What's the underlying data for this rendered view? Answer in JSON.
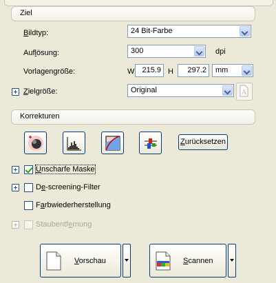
{
  "ziel": {
    "header": "Ziel",
    "bildtyp_label_pre": "",
    "bildtyp_label_ul": "B",
    "bildtyp_label_post": "ildtyp:",
    "bildtyp_value": "24 Bit-Farbe",
    "aufloesung_label_pre": "Auf",
    "aufloesung_label_ul": "l",
    "aufloesung_label_post": "ösung:",
    "aufloesung_value": "300",
    "aufloesung_unit": "dpi",
    "vorlagengroesse_label": "Vorlagengröße:",
    "w_label": "W",
    "w_value": "215.9",
    "h_label": "H",
    "h_value": "297.2",
    "unit_value": "mm",
    "zielgroesse_label_ul": "Z",
    "zielgroesse_label_post": "ielgröße:",
    "zielgroesse_value": "Original"
  },
  "korrekturen": {
    "header": "Korrekturen",
    "reset_label_pre": "",
    "reset_label_ul": "Z",
    "reset_label_post": "urücksetzen",
    "options": {
      "unscharf_ul": "U",
      "unscharf_post": "nscharfe Maske",
      "unscharf_checked": true,
      "descreening_pre": "D",
      "descreening_ul": "e",
      "descreening_post": "-screening-Filter",
      "farb_pre": "F",
      "farb_ul": "a",
      "farb_post": "rbwiederherstellung",
      "staub_pre": "Staubentf",
      "staub_ul": "e",
      "staub_post": "rnung"
    }
  },
  "buttons": {
    "vorschau_ul": "V",
    "vorschau_post": "orschau",
    "scannen_ul": "S",
    "scannen_post": "cannen"
  }
}
